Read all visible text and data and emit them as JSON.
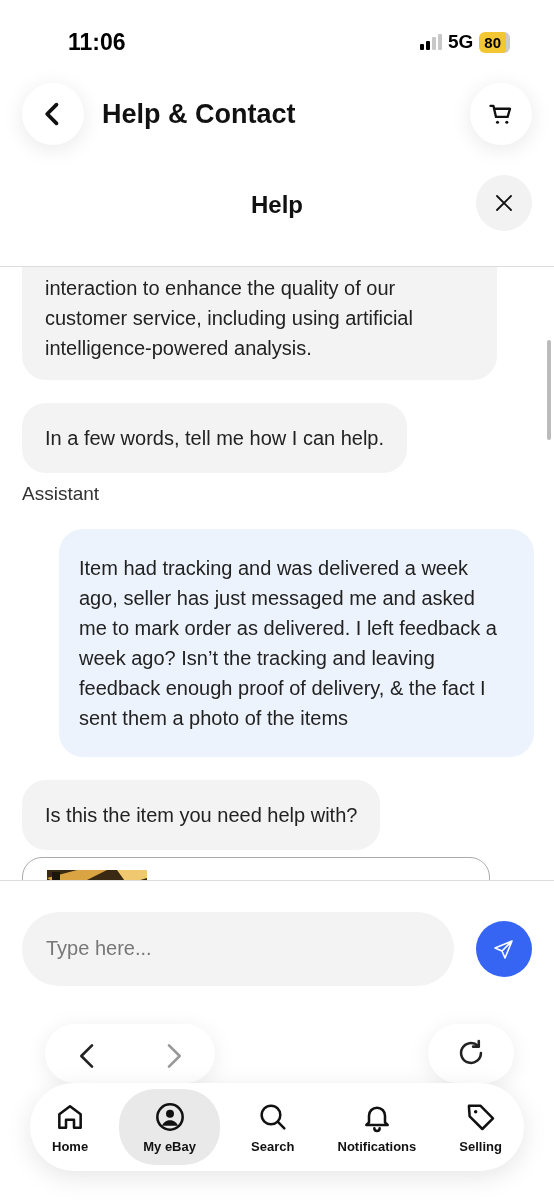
{
  "status_bar": {
    "time": "11:06",
    "network": "5G",
    "battery": "80"
  },
  "header": {
    "title": "Help & Contact"
  },
  "sheet": {
    "title": "Help"
  },
  "messages": [
    {
      "kind": "agent",
      "text": "interaction to enhance the quality of our customer service, including using artificial intelligence-powered analysis."
    },
    {
      "kind": "agent",
      "text": "In a few words, tell me how I can help."
    },
    {
      "kind": "label",
      "text": "Assistant"
    },
    {
      "kind": "user",
      "text": "Item had tracking and was delivered a week ago, seller has just messaged me and asked me to mark order as delivered. I left feedback a week ago? Isn’t the tracking and leaving feedback enough proof of delivery, & the fact I sent them a photo of the items"
    },
    {
      "kind": "agent",
      "text": "Is this the item you need help with?"
    },
    {
      "kind": "item_card"
    }
  ],
  "composer": {
    "placeholder": "Type here..."
  },
  "browser_nav": {
    "back": {
      "disabled": false
    },
    "forward": {
      "disabled": true
    }
  },
  "tabs": [
    {
      "kind": "home",
      "label": "Home",
      "selected": false
    },
    {
      "kind": "person",
      "label": "My eBay",
      "selected": true
    },
    {
      "kind": "search",
      "label": "Search",
      "selected": false
    },
    {
      "kind": "bell",
      "label": "Notifications",
      "selected": false
    },
    {
      "kind": "tag",
      "label": "Selling",
      "selected": false
    }
  ]
}
